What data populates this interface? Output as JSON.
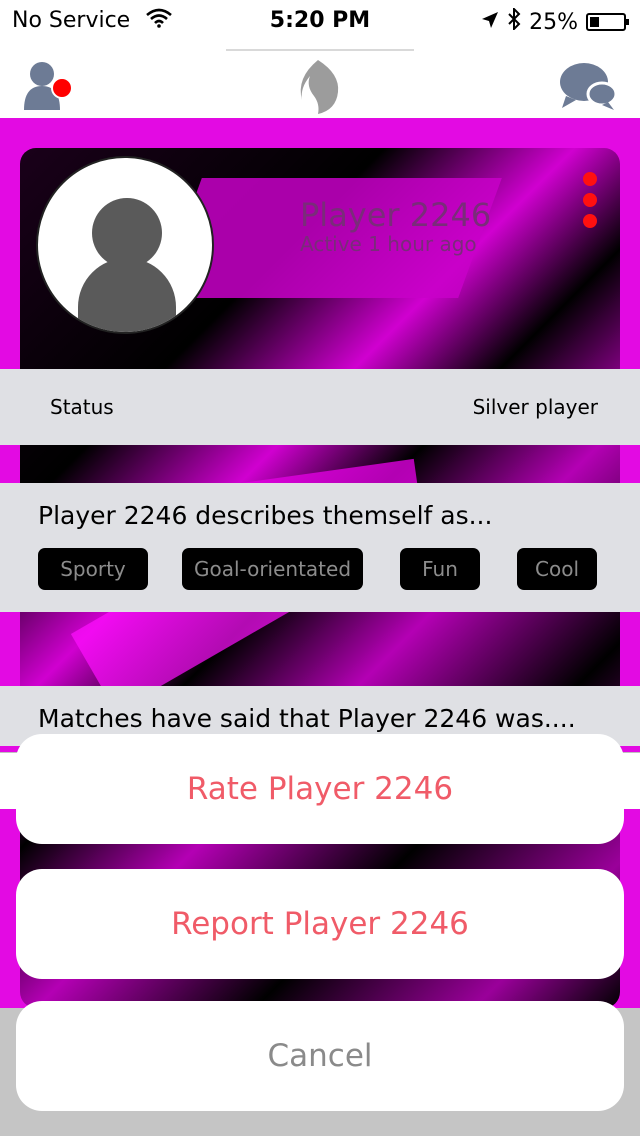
{
  "status_bar": {
    "carrier": "No Service",
    "time": "5:20 PM",
    "battery": "25%"
  },
  "nav": {
    "left_icon": "profile-icon",
    "center_icon": "flame-icon",
    "right_icon": "chat-icon"
  },
  "profile": {
    "name": "Player 2246",
    "active": "Active 1 hour ago",
    "status_label": "Status",
    "status_value": "Silver player",
    "describes_heading": "Player 2246 describes themself as...",
    "tags": [
      "Sporty",
      "Goal-orientated",
      "Fun",
      "Cool"
    ],
    "matches_heading": "Matches have said that Player 2246 was...."
  },
  "action_sheet": {
    "rate": "Rate Player 2246",
    "report": "Report Player 2246",
    "cancel": "Cancel"
  },
  "colors": {
    "accent_magenta": "#e30ae3",
    "action_red": "#f05b68",
    "notification_dot": "#ff1010"
  }
}
